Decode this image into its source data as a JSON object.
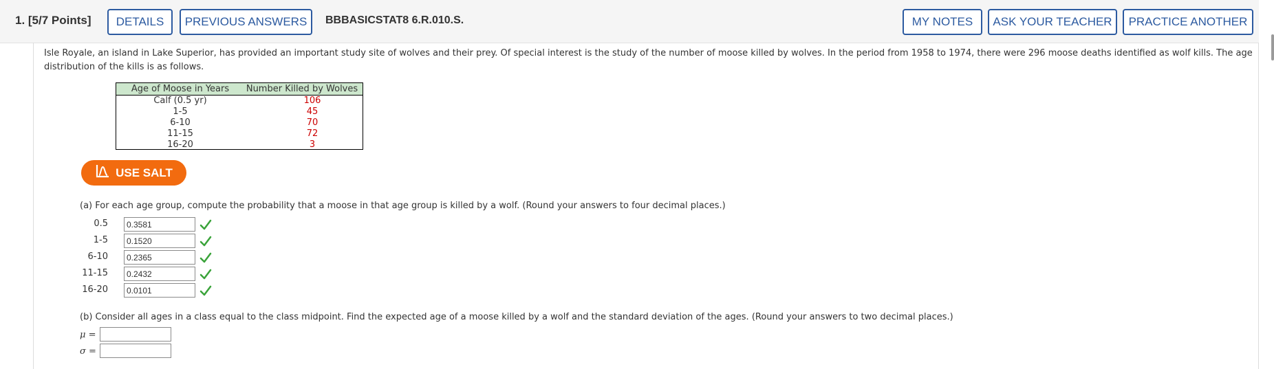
{
  "header": {
    "question_number": "1. [5/7 Points]",
    "details_label": "DETAILS",
    "previous_answers_label": "PREVIOUS ANSWERS",
    "question_id": "BBBASICSTAT8 6.R.010.S.",
    "my_notes_label": "MY NOTES",
    "ask_teacher_label": "ASK YOUR TEACHER",
    "practice_another_label": "PRACTICE ANOTHER"
  },
  "intro": {
    "text": "Isle Royale, an island in Lake Superior, has provided an important study site of wolves and their prey. Of special interest is the study of the number of moose killed by wolves. In the period from 1958 to 1974, there were 296 moose deaths identified as wolf kills. The age distribution of the kills is as follows."
  },
  "table": {
    "headers": [
      "Age of Moose in Years",
      "Number Killed by Wolves"
    ],
    "rows": [
      {
        "age": "Calf (0.5 yr)",
        "killed": "106"
      },
      {
        "age": "1-5",
        "killed": "45"
      },
      {
        "age": "6-10",
        "killed": "70"
      },
      {
        "age": "11-15",
        "killed": "72"
      },
      {
        "age": "16-20",
        "killed": "3"
      }
    ]
  },
  "salt": {
    "label": "USE SALT",
    "icon": "salt-chart-icon",
    "color": "#f26b0f"
  },
  "part_a": {
    "prompt": "(a) For each age group, compute the probability that a moose in that age group is killed by a wolf. (Round your answers to four decimal places.)",
    "rows": [
      {
        "label": "0.5",
        "value": "0.3581",
        "status": "correct"
      },
      {
        "label": "1-5",
        "value": "0.1520",
        "status": "correct"
      },
      {
        "label": "6-10",
        "value": "0.2365",
        "status": "correct"
      },
      {
        "label": "11-15",
        "value": "0.2432",
        "status": "correct"
      },
      {
        "label": "16-20",
        "value": "0.0101",
        "status": "correct"
      }
    ]
  },
  "part_b": {
    "prompt": "(b) Consider all ages in a class equal to the class midpoint. Find the expected age of a moose killed by a wolf and the standard deviation of the ages. (Round your answers to two decimal places.)",
    "mu_label": "μ =",
    "sigma_label": "σ =",
    "mu_value": "",
    "sigma_value": ""
  },
  "colors": {
    "accent": "#2c5aa0",
    "table_header_bg": "#cde7cd",
    "answer_red": "#cc0000",
    "check_green": "#3aa33a"
  }
}
